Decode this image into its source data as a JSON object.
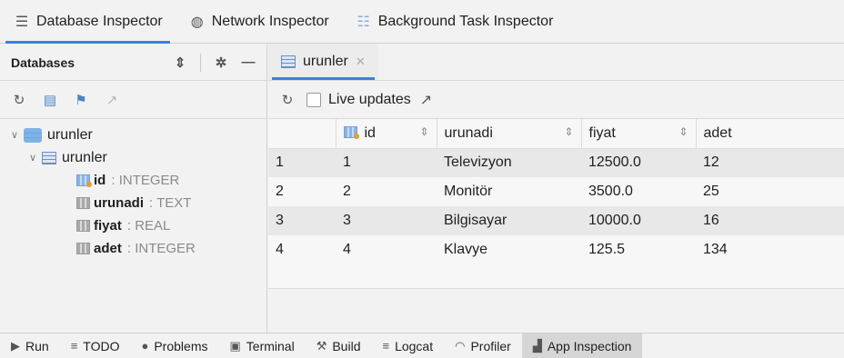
{
  "top_tabs": [
    {
      "label": "Database Inspector",
      "icon": "database-icon"
    },
    {
      "label": "Network Inspector",
      "icon": "globe-icon"
    },
    {
      "label": "Background Task Inspector",
      "icon": "list-icon"
    }
  ],
  "databases_panel": {
    "title": "Databases",
    "tree": {
      "database": "urunler",
      "table": "urunler",
      "columns": [
        {
          "name": "id",
          "type": "INTEGER",
          "primary_key": true
        },
        {
          "name": "urunadi",
          "type": "TEXT",
          "primary_key": false
        },
        {
          "name": "fiyat",
          "type": "REAL",
          "primary_key": false
        },
        {
          "name": "adet",
          "type": "INTEGER",
          "primary_key": false
        }
      ]
    }
  },
  "table_tab": {
    "label": "urunler",
    "live_updates_label": "Live updates"
  },
  "grid": {
    "columns": [
      "",
      "id",
      "urunadi",
      "fiyat",
      "adet"
    ],
    "rows": [
      [
        "1",
        "1",
        "Televizyon",
        "12500.0",
        "12"
      ],
      [
        "2",
        "2",
        "Monitör",
        "3500.0",
        "25"
      ],
      [
        "3",
        "3",
        "Bilgisayar",
        "10000.0",
        "16"
      ],
      [
        "4",
        "4",
        "Klavye",
        "125.5",
        "134"
      ]
    ]
  },
  "bottom_bar": [
    {
      "label": "Run",
      "icon": "run-icon"
    },
    {
      "label": "TODO",
      "icon": "todo-icon"
    },
    {
      "label": "Problems",
      "icon": "problems-icon"
    },
    {
      "label": "Terminal",
      "icon": "terminal-icon"
    },
    {
      "label": "Build",
      "icon": "build-icon"
    },
    {
      "label": "Logcat",
      "icon": "logcat-icon"
    },
    {
      "label": "Profiler",
      "icon": "profiler-icon"
    },
    {
      "label": "App Inspection",
      "icon": "app-inspection-icon",
      "active": true
    }
  ]
}
